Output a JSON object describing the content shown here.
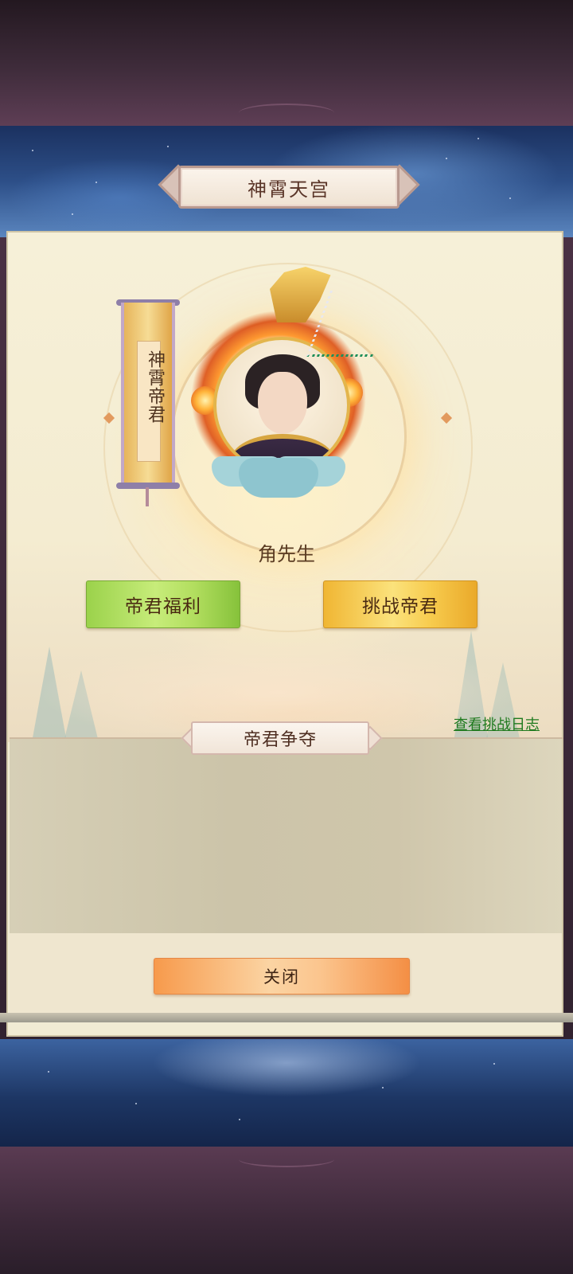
{
  "header": {
    "title": "神霄天宫"
  },
  "emperor": {
    "banner_text": "神霄帝君",
    "name": "角先生",
    "portrait": "emperor-portrait"
  },
  "actions": {
    "benefit_label": "帝君福利",
    "challenge_label": "挑战帝君",
    "log_link": "查看挑战日志"
  },
  "section": {
    "title": "帝君争夺"
  },
  "footer": {
    "close_label": "关闭"
  },
  "colors": {
    "panel_bg": "#f1ebd4",
    "benefit_green": "#9bd24b",
    "challenge_gold": "#f0b633",
    "close_orange": "#f79a4c",
    "link_green": "#1f7a1e"
  }
}
